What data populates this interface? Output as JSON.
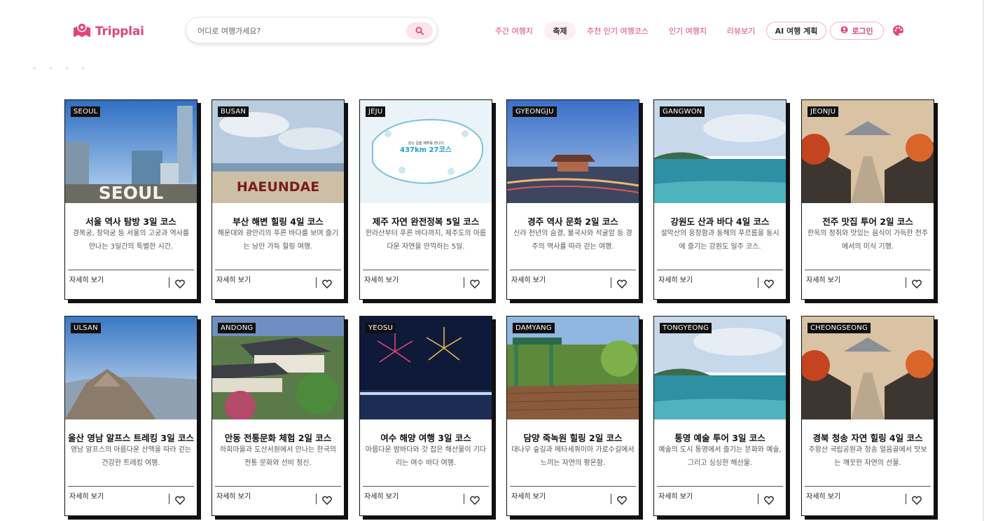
{
  "brand": {
    "name": "Tripplai"
  },
  "search": {
    "placeholder": "어디로 여행가세요?"
  },
  "nav": {
    "weekly": "주간 여행지",
    "festival": "축제",
    "recommended": "추천 인기 여행코스",
    "popular": "인기 여행지",
    "reviews": "리뷰보기",
    "ai_plan": "AI 여행 계획",
    "login": "로그인"
  },
  "colors": {
    "brand": "#e2457a",
    "pill_bg": "#fdeef3",
    "card_border": "#111111"
  },
  "icons": {
    "logo": "map-pin-logo-icon",
    "search": "search-icon",
    "login": "user-circle-icon",
    "theme": "palette-icon",
    "like": "heart-icon"
  },
  "cards": [
    {
      "region": "SEOUL",
      "title": "서울 역사 탐방 3일 코스",
      "desc": "경복궁, 창덕궁 등 서울의 고궁과 역사를 만나는 3일간의 특별한 시간.",
      "image_text": "SEOUL",
      "more": "자세히 보기"
    },
    {
      "region": "BUSAN",
      "title": "부산 해변 힐링 4일 코스",
      "desc": "해운대와 광안리의 푸른 바다를 보며 즐기는 낭만 가득 힐링 여행.",
      "image_text": "HAEUNDAE",
      "more": "자세히 보기"
    },
    {
      "region": "JEJU",
      "title": "제주 자연 완전정복 5일 코스",
      "desc": "한라산부터 푸른 바다까지, 제주도의 아름다운 자연을 만끽하는 5일.",
      "image_text": "437km 27코스",
      "image_subtext": "걷는 길을 제주를 만나다",
      "more": "자세히 보기"
    },
    {
      "region": "GYEONGJU",
      "title": "경주 역사 문화 2일 코스",
      "desc": "신라 천년의 숨결, 불국사와 석굴암 등 경주의 역사를 따라 걷는 여행.",
      "more": "자세히 보기"
    },
    {
      "region": "GANGWON",
      "title": "강원도 산과 바다 4일 코스",
      "desc": "설악산의 웅장함과 동해의 푸르름을 동시에 즐기는 강원도 일주 코스.",
      "more": "자세히 보기"
    },
    {
      "region": "JEONJU",
      "title": "전주 맛집 투어 2일 코스",
      "desc": "한옥의 정취와 맛있는 음식이 가득한 전주에서의 미식 기행.",
      "more": "자세히 보기"
    },
    {
      "region": "ULSAN",
      "title": "울산 영남 알프스 트레킹 3일 코스",
      "desc": "영남 알프스의 아름다운 산맥을 따라 걷는 건강한 트레킹 여행.",
      "more": "자세히 보기"
    },
    {
      "region": "ANDONG",
      "title": "안동 전통문화 체험 2일 코스",
      "desc": "하회마을과 도산서원에서 만나는 한국의 전통 문화와 선비 정신.",
      "more": "자세히 보기"
    },
    {
      "region": "YEOSU",
      "title": "여수 해양 여행 3일 코스",
      "desc": "아름다운 밤바다와 갓 잡은 해산물이 기다리는 여수 바다 여행.",
      "more": "자세히 보기"
    },
    {
      "region": "DAMYANG",
      "title": "담양 죽녹원 힐링 2일 코스",
      "desc": "대나무 숲길과 메타세쿼이아 가로수길에서 느끼는 자연의 평온함.",
      "more": "자세히 보기"
    },
    {
      "region": "TONGYEONG",
      "title": "통영 예술 투어 3일 코스",
      "desc": "예술의 도시 통영에서 즐기는 문화와 예술, 그리고 싱싱한 해산물.",
      "more": "자세히 보기"
    },
    {
      "region": "CHEONGSEONG",
      "title": "경북 청송 자연 힐링 4일 코스",
      "desc": "주왕산 국립공원과 청송 얼음골에서 맛보는 깨끗한 자연의 선물.",
      "more": "자세히 보기"
    }
  ]
}
